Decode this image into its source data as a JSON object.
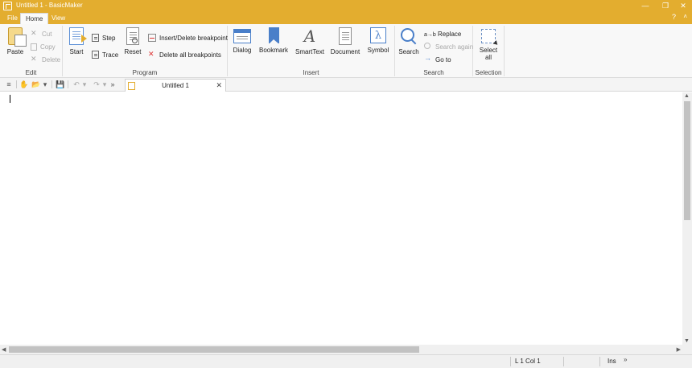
{
  "window": {
    "title": "Untitled 1 - BasicMaker",
    "minimize_glyph": "—",
    "restore_glyph": "❐",
    "close_glyph": "✕"
  },
  "menu": {
    "tabs": [
      {
        "label": "File"
      },
      {
        "label": "Home"
      },
      {
        "label": "View"
      }
    ],
    "active_tab": "Home",
    "help_glyph": "?",
    "collapse_glyph": "˄"
  },
  "ribbon": {
    "edit": {
      "label": "Edit",
      "paste": "Paste",
      "cut": "Cut",
      "copy": "Copy",
      "delete": "Delete"
    },
    "program": {
      "label": "Program",
      "start": "Start",
      "step": "Step",
      "trace": "Trace",
      "reset": "Reset",
      "insert_breakpoint": "Insert/Delete breakpoint",
      "delete_breakpoints": "Delete all breakpoints"
    },
    "insert": {
      "label": "Insert",
      "dialog": "Dialog",
      "bookmark": "Bookmark",
      "smarttext": "SmartText",
      "document": "Document",
      "symbol": "Symbol",
      "symbol_glyph": "λ",
      "smarttext_glyph": "A"
    },
    "search": {
      "label": "Search",
      "search": "Search",
      "replace": "Replace",
      "replace_prefix": "a→b",
      "search_again": "Search again",
      "goto": "Go to"
    },
    "selection": {
      "label": "Selection",
      "select_all_line1": "Select",
      "select_all_line2": "all"
    }
  },
  "quick_access": {
    "menu_glyph": "≡",
    "hand_glyph": "✋",
    "open_glyph": "📂",
    "dropdown_glyph": "▾",
    "save_glyph": "💾",
    "undo_glyph": "↶",
    "redo_glyph": "↷",
    "more_glyph": "»"
  },
  "document_tab": {
    "label": "Untitled 1",
    "close_glyph": "✕"
  },
  "scrollbars": {
    "up": "▲",
    "down": "▼",
    "left": "◀",
    "right": "▶"
  },
  "statusbar": {
    "position": "L 1 Col 1",
    "mode": "Ins",
    "more_glyph": "»"
  },
  "colors": {
    "accent": "#e3ad2f",
    "ribbon_bg": "#f8f8f8",
    "icon_blue": "#4a7fc9"
  }
}
